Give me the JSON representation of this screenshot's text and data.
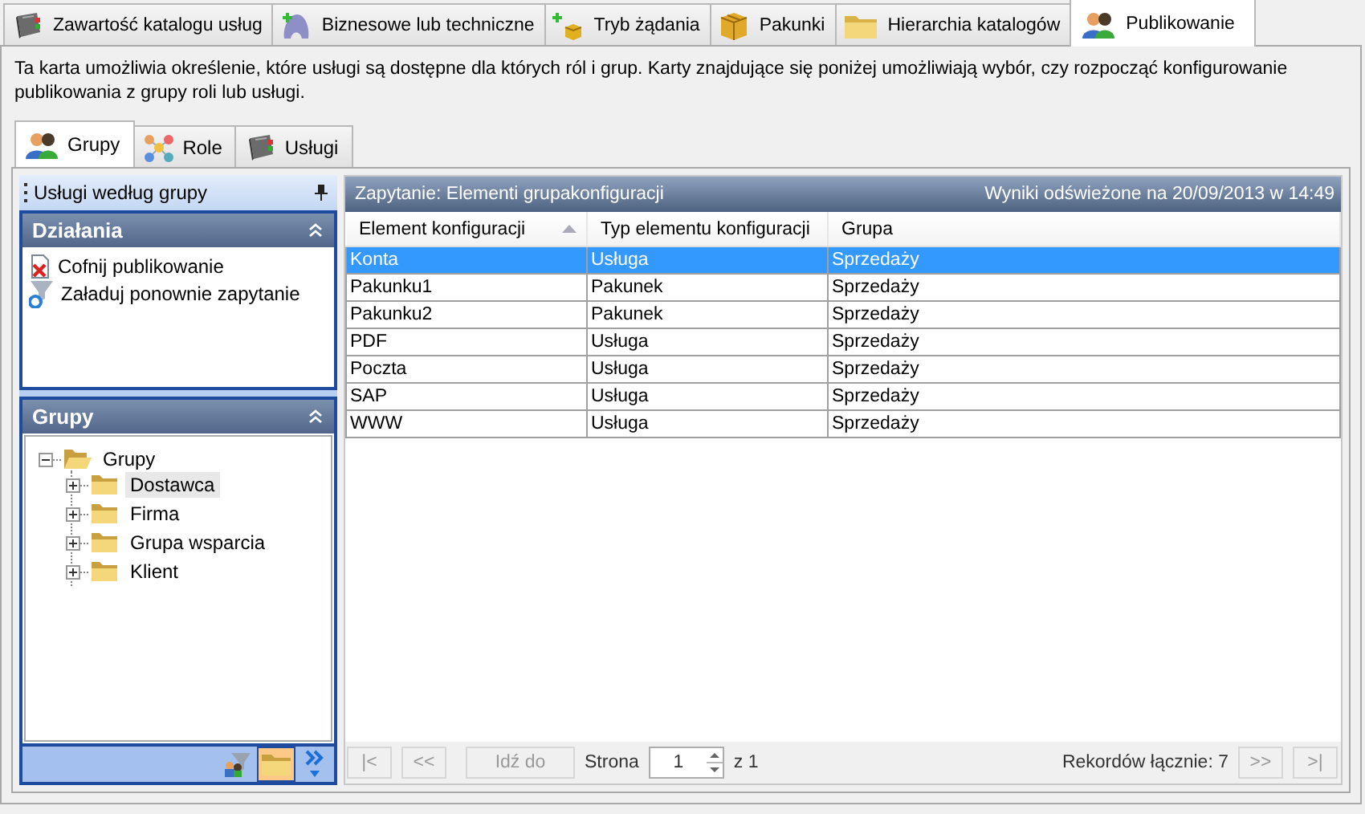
{
  "tabs": [
    {
      "label": "Zawartość katalogu usług",
      "selected": false
    },
    {
      "label": "Biznesowe lub techniczne",
      "selected": false
    },
    {
      "label": "Tryb żądania",
      "selected": false
    },
    {
      "label": "Pakunki",
      "selected": false
    },
    {
      "label": "Hierarchia katalogów",
      "selected": false
    },
    {
      "label": "Publikowanie",
      "selected": true
    }
  ],
  "description": "Ta karta umożliwia określenie, które usługi są dostępne dla których ról i grup. Karty znajdujące się poniżej umożliwiają wybór, czy rozpocząć konfigurowanie publikowania z grupy roli lub usługi.",
  "subtabs": [
    {
      "label": "Grupy",
      "selected": true
    },
    {
      "label": "Role",
      "selected": false
    },
    {
      "label": "Usługi",
      "selected": false
    }
  ],
  "sidebar": {
    "title": "Usługi według grupy",
    "actions": {
      "title": "Działania",
      "expanded": true,
      "items": [
        "Cofnij publikowanie",
        "Załaduj ponownie zapytanie"
      ]
    },
    "groups": {
      "title": "Grupy",
      "expanded": true,
      "tree": [
        {
          "label": "Grupy",
          "expanded": true,
          "selected": false,
          "children": [
            {
              "label": "Dostawca",
              "expanded": false,
              "selected": true
            },
            {
              "label": "Firma",
              "expanded": false,
              "selected": false
            },
            {
              "label": "Grupa wsparcia",
              "expanded": false,
              "selected": false
            },
            {
              "label": "Klient",
              "expanded": false,
              "selected": false
            }
          ]
        }
      ]
    },
    "view_buttons": [
      {
        "selected": false
      },
      {
        "selected": true
      }
    ]
  },
  "query": {
    "title": "Zapytanie: Elementi grupakonfiguracji",
    "refreshed": "Wyniki odświeżone na 20/09/2013 w 14:49"
  },
  "table": {
    "columns": [
      {
        "label": "Element konfiguracji",
        "sorted": true
      },
      {
        "label": "Typ elementu konfiguracji",
        "sorted": false
      },
      {
        "label": "Grupa",
        "sorted": false
      }
    ],
    "rows": [
      {
        "cells": [
          "Konta",
          "Usługa",
          "Sprzedaży"
        ],
        "selected": true
      },
      {
        "cells": [
          "Pakunku1",
          "Pakunek",
          "Sprzedaży"
        ],
        "selected": false
      },
      {
        "cells": [
          "Pakunku2",
          "Pakunek",
          "Sprzedaży"
        ],
        "selected": false
      },
      {
        "cells": [
          "PDF",
          "Usługa",
          "Sprzedaży"
        ],
        "selected": false
      },
      {
        "cells": [
          "Poczta",
          "Usługa",
          "Sprzedaży"
        ],
        "selected": false
      },
      {
        "cells": [
          "SAP",
          "Usługa",
          "Sprzedaży"
        ],
        "selected": false
      },
      {
        "cells": [
          "WWW",
          "Usługa",
          "Sprzedaży"
        ],
        "selected": false
      }
    ]
  },
  "pager": {
    "first": {
      "label": "|<",
      "disabled": true
    },
    "prev": {
      "label": "<<",
      "disabled": true
    },
    "goto": {
      "label": "Idź do",
      "disabled": true
    },
    "page_label": "Strona",
    "page_value": "1",
    "page_total": "z 1",
    "records": "Rekordów łącznie: 7",
    "next": {
      "label": ">>",
      "disabled": true
    },
    "last": {
      "label": ">|",
      "disabled": true
    }
  }
}
